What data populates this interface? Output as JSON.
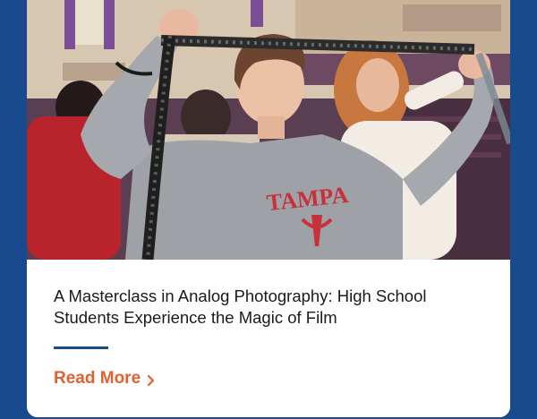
{
  "article": {
    "title": "A Masterclass in Analog Photography: High School Students Experience the Magic of Film",
    "read_more_label": "Read More",
    "read_more_icon": "chevron-right-icon",
    "photo_shirt_text": "TAMPA"
  },
  "colors": {
    "background": "#1a4a8e",
    "card": "#ffffff",
    "accent": "#e0622e",
    "divider": "#1a4a8e"
  }
}
